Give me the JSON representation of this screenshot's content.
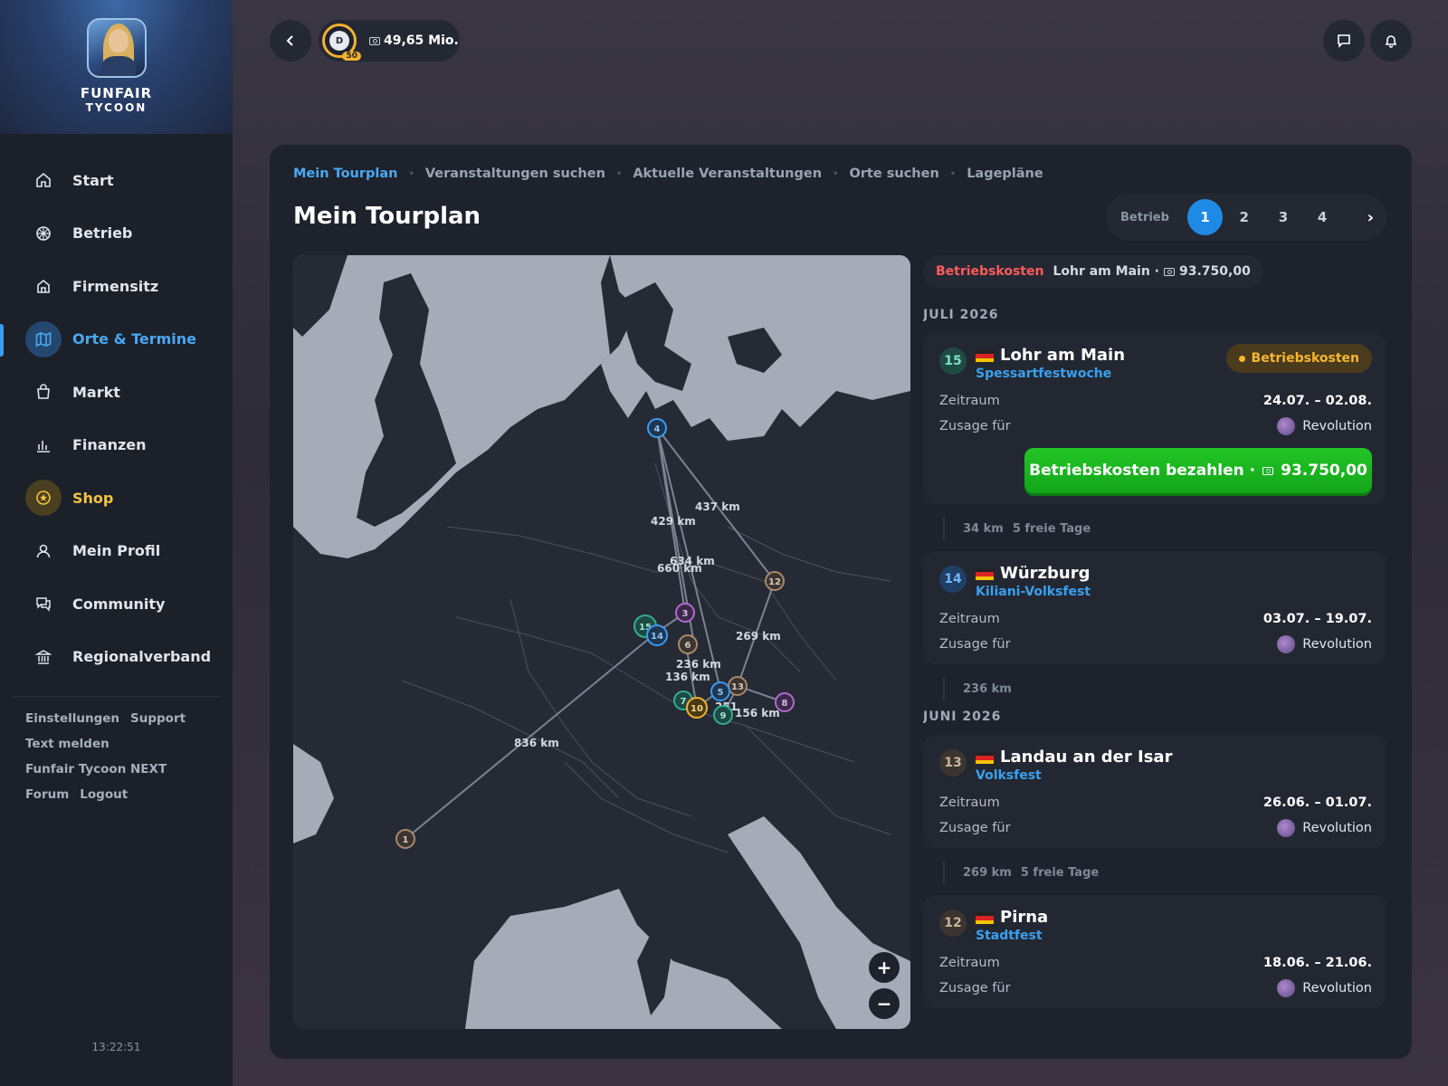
{
  "logo": {
    "title": "FUNFAIR",
    "subtitle": "TYCOON"
  },
  "nav": [
    {
      "label": "Start",
      "icon": "home-icon"
    },
    {
      "label": "Betrieb",
      "icon": "ferris-wheel-icon"
    },
    {
      "label": "Firmensitz",
      "icon": "building-icon"
    },
    {
      "label": "Orte & Termine",
      "icon": "map-icon",
      "active": true
    },
    {
      "label": "Markt",
      "icon": "bag-icon"
    },
    {
      "label": "Finanzen",
      "icon": "chart-icon"
    },
    {
      "label": "Shop",
      "icon": "shop-icon"
    },
    {
      "label": "Mein Profil",
      "icon": "user-icon"
    },
    {
      "label": "Community",
      "icon": "chat-icon"
    },
    {
      "label": "Regionalverband",
      "icon": "bank-icon"
    }
  ],
  "footer_links": [
    "Einstellungen",
    "Support",
    "Text melden",
    "Funfair Tycoon NEXT",
    "Forum",
    "Logout"
  ],
  "clock": "13:22:51",
  "wallet": {
    "level": "50",
    "money": "49,65 Mio."
  },
  "tabs": [
    "Mein Tourplan",
    "Veranstaltungen suchen",
    "Aktuelle Veranstaltungen",
    "Orte suchen",
    "Lagepläne"
  ],
  "page_title": "Mein Tourplan",
  "pager": {
    "label": "Betrieb",
    "pages": [
      "1",
      "2",
      "3",
      "4"
    ],
    "next": "›"
  },
  "map": {
    "zoom_in": "+",
    "zoom_out": "−",
    "distance_labels": [
      "437 km",
      "429 km",
      "634 km",
      "660 km",
      "269 km",
      "236 km",
      "136 km",
      "251",
      "156 km",
      "836 km"
    ],
    "markers": [
      "1",
      "3",
      "4",
      "5",
      "6",
      "7",
      "8",
      "9",
      "10",
      "12",
      "13",
      "14",
      "15"
    ]
  },
  "cost_chip": {
    "label": "Betriebskosten",
    "place": "Lohr am Main ·",
    "amount": "93.750,00"
  },
  "months": {
    "july": "JULI 2026",
    "june": "JUNI 2026"
  },
  "labels": {
    "zeitraum": "Zeitraum",
    "zusage": "Zusage für",
    "revolution": "Revolution"
  },
  "cards": [
    {
      "num": "15",
      "city": "Lohr am Main",
      "event": "Spessartfestwoche",
      "badge": "Betriebskosten",
      "dates": "24.07.  –  02.08.",
      "pay": "Betriebskosten bezahlen ·",
      "pay_amount": "93.750,00"
    },
    {
      "num": "14",
      "city": "Würzburg",
      "event": "Kiliani-Volksfest",
      "dates": "03.07.  –  19.07."
    },
    {
      "num": "13",
      "city": "Landau an der Isar",
      "event": "Volksfest",
      "dates": "26.06.  –  01.07."
    },
    {
      "num": "12",
      "city": "Pirna",
      "event": "Stadtfest",
      "dates": "18.06.  –  21.06."
    }
  ],
  "gaps": [
    {
      "km": "34 km",
      "days": "5 freie Tage"
    },
    {
      "km": "236 km",
      "days": ""
    },
    {
      "km": "269 km",
      "days": "5 freie Tage"
    }
  ],
  "colors": {
    "accent": "#1f8ae6",
    "shop": "#f4c341",
    "danger": "#ff5b5b",
    "success": "#16b31c",
    "warning": "#f7b631"
  }
}
